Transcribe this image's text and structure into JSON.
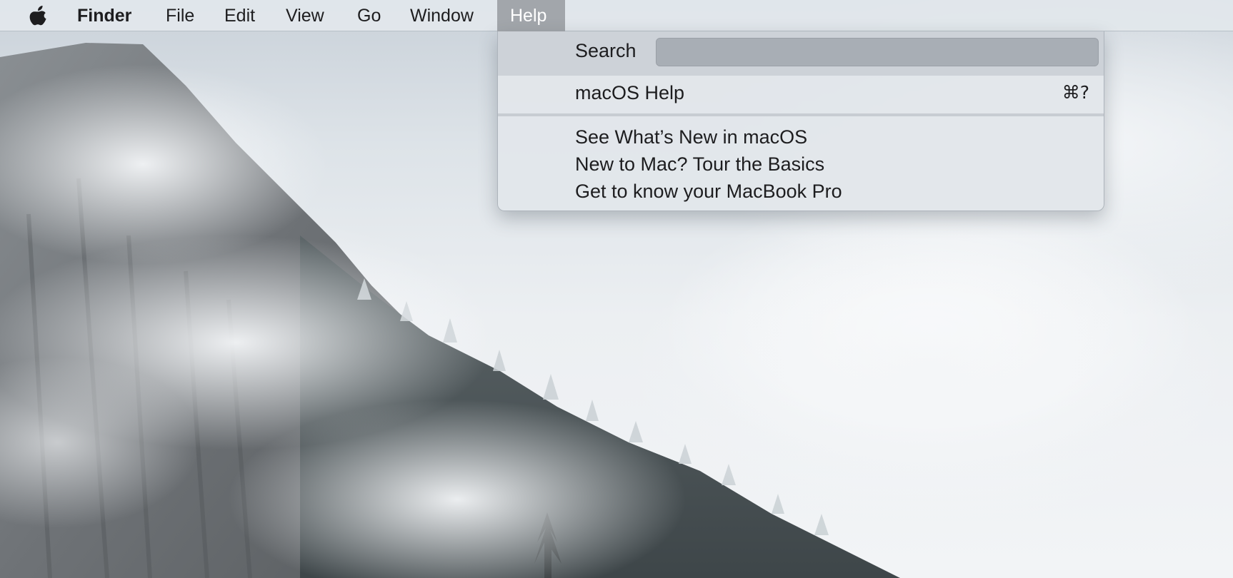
{
  "menubar": {
    "apple_icon": "apple-logo-icon",
    "app_name": "Finder",
    "items": [
      "File",
      "Edit",
      "View",
      "Go",
      "Window",
      "Help"
    ],
    "active_item": "Help"
  },
  "help_menu": {
    "search_label": "Search",
    "search_value": "",
    "macos_help": "macOS Help",
    "macos_help_shortcut": "⌘?",
    "whats_new": "See What’s New in macOS",
    "tour": "New to Mac? Tour the Basics",
    "know_mac": "Get to know your MacBook Pro"
  },
  "colors": {
    "menubar_bg": "#e2e7ec",
    "active_menu_bg": "#a2a6ab",
    "dropdown_bg": "#e2e6ea",
    "search_row_bg": "#cdd2d8",
    "search_field_bg": "#a8aeb5"
  },
  "wallpaper": {
    "subject": "snowy mountain cliff with fog"
  }
}
